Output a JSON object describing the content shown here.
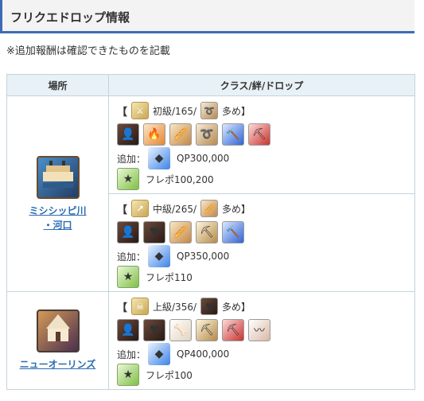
{
  "heading": "フリクエドロップ情報",
  "note": "※追加報酬は確認できたものを記載",
  "table": {
    "headers": [
      "場所",
      "クラス/絆/ドロップ"
    ],
    "rows": [
      {
        "place": "ミシシッピ川\n・河口",
        "place_lines": [
          "ミシシッピ川",
          "・河口"
        ],
        "place_icon": "mississippi-river-icon",
        "quests": [
          {
            "open": "【",
            "class_icon": "saber-class-icon",
            "level_text": "初級/165/",
            "many_icon": "horn-item-icon",
            "many_text": "多め】",
            "items": [
              "servant-icon",
              "flame-feather-icon",
              "bread-icon",
              "horn-icon",
              "blue-hammer-icon",
              "red-shovel-icon"
            ],
            "add_label": "追加：",
            "qp_icon": "qp-gem-icon",
            "qp": "QP300,000",
            "fp_icon": "friend-point-icon",
            "fp": "フレポ100,200"
          },
          {
            "open": "【",
            "class_icon": "lancer-class-icon",
            "level_text": "中級/265/",
            "many_icon": "bread-item-icon",
            "many_text": "多め】",
            "items": [
              "servant-icon",
              "heart-stone-icon",
              "bread-icon",
              "pickaxe-icon",
              "blue-hammer-icon"
            ],
            "add_label": "追加：",
            "qp_icon": "qp-gem-icon",
            "qp": "QP350,000",
            "fp_icon": "friend-point-icon",
            "fp": "フレポ110"
          }
        ]
      },
      {
        "place": "ニューオーリンズ",
        "place_lines": [
          "ニューオーリンズ"
        ],
        "place_icon": "new-orleans-icon",
        "quests": [
          {
            "open": "【",
            "class_icon": "berserker-class-icon",
            "level_text": "上級/356/",
            "many_icon": "heart-stone-item-icon",
            "many_text": "多め】",
            "items": [
              "servant-icon",
              "heart-stone-icon",
              "bone-icon",
              "pickaxe-icon",
              "red-shovel-icon",
              "whip-icon"
            ],
            "add_label": "追加：",
            "qp_icon": "qp-gem-icon",
            "qp": "QP400,000",
            "fp_icon": "friend-point-icon",
            "fp": "フレポ100"
          }
        ]
      }
    ]
  },
  "colors": {
    "accent": "#3d6bb3",
    "link": "#2b6db3",
    "header_bg": "#e8f1f6",
    "border": "#c6d3dc"
  }
}
